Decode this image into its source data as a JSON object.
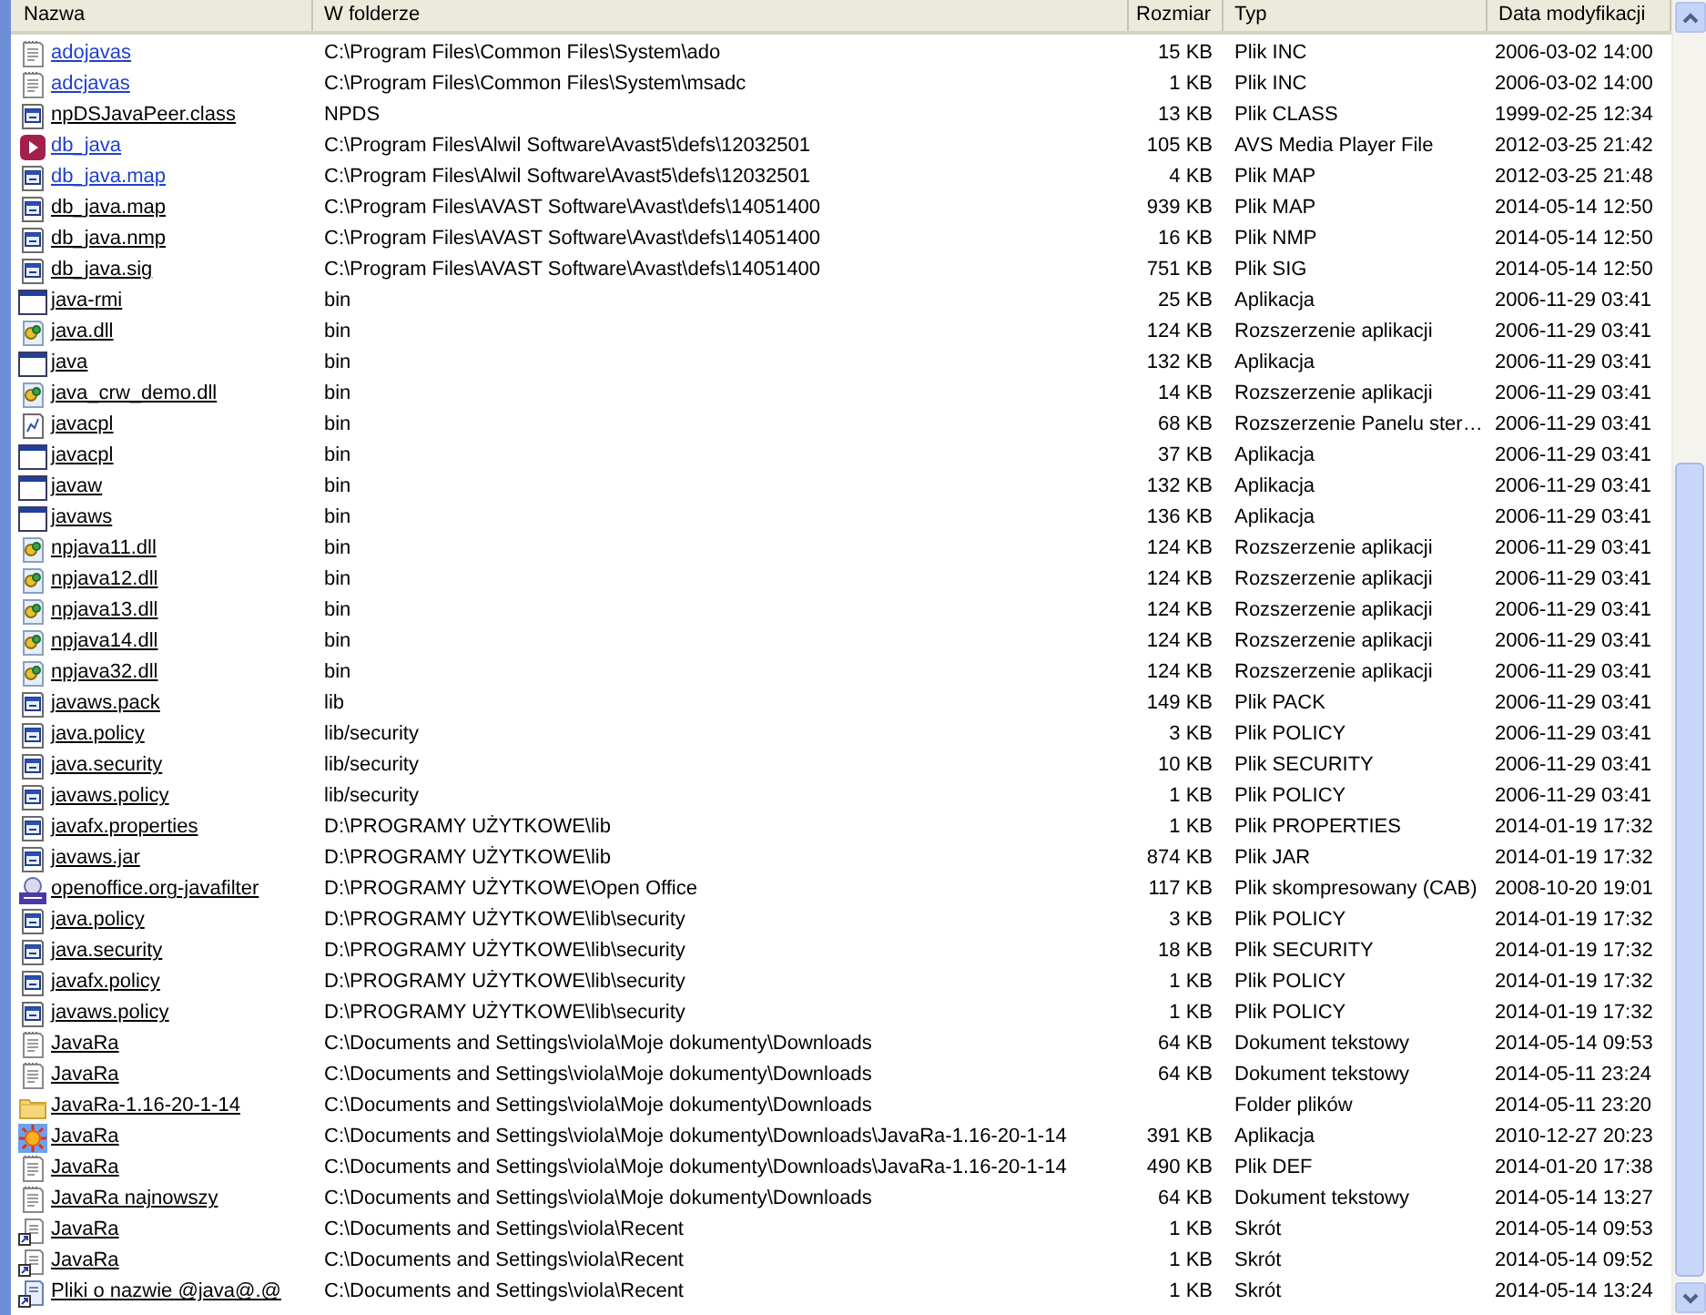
{
  "columns": [
    "Nazwa",
    "W folderze",
    "Rozmiar",
    "Typ",
    "Data modyfikacji"
  ],
  "rows": [
    {
      "kind": "text",
      "name": "adojavas",
      "visited": true,
      "folder": "C:\\Program Files\\Common Files\\System\\ado",
      "size": "15 KB",
      "type": "Plik INC",
      "date": "2006-03-02 14:00"
    },
    {
      "kind": "text",
      "name": "adcjavas",
      "visited": true,
      "folder": "C:\\Program Files\\Common Files\\System\\msadc",
      "size": "1 KB",
      "type": "Plik INC",
      "date": "2006-03-02 14:00"
    },
    {
      "kind": "doc",
      "name": "npDSJavaPeer.class",
      "visited": false,
      "folder": "NPDS",
      "size": "13 KB",
      "type": "Plik CLASS",
      "date": "1999-02-25 12:34"
    },
    {
      "kind": "media",
      "name": "db_java",
      "visited": true,
      "folder": "C:\\Program Files\\Alwil Software\\Avast5\\defs\\12032501",
      "size": "105 KB",
      "type": "AVS Media Player File",
      "date": "2012-03-25 21:42"
    },
    {
      "kind": "doc",
      "name": "db_java.map",
      "visited": true,
      "folder": "C:\\Program Files\\Alwil Software\\Avast5\\defs\\12032501",
      "size": "4 KB",
      "type": "Plik MAP",
      "date": "2012-03-25 21:48"
    },
    {
      "kind": "doc",
      "name": "db_java.map",
      "visited": false,
      "folder": "C:\\Program Files\\AVAST Software\\Avast\\defs\\14051400",
      "size": "939 KB",
      "type": "Plik MAP",
      "date": "2014-05-14 12:50"
    },
    {
      "kind": "doc",
      "name": "db_java.nmp",
      "visited": false,
      "folder": "C:\\Program Files\\AVAST Software\\Avast\\defs\\14051400",
      "size": "16 KB",
      "type": "Plik NMP",
      "date": "2014-05-14 12:50"
    },
    {
      "kind": "doc",
      "name": "db_java.sig",
      "visited": false,
      "folder": "C:\\Program Files\\AVAST Software\\Avast\\defs\\14051400",
      "size": "751 KB",
      "type": "Plik SIG",
      "date": "2014-05-14 12:50"
    },
    {
      "kind": "window",
      "name": "java-rmi",
      "visited": false,
      "folder": "bin",
      "size": "25 KB",
      "type": "Aplikacja",
      "date": "2006-11-29 03:41"
    },
    {
      "kind": "dll",
      "name": "java.dll",
      "visited": false,
      "folder": "bin",
      "size": "124 KB",
      "type": "Rozszerzenie aplikacji",
      "date": "2006-11-29 03:41"
    },
    {
      "kind": "window",
      "name": "java",
      "visited": false,
      "folder": "bin",
      "size": "132 KB",
      "type": "Aplikacja",
      "date": "2006-11-29 03:41"
    },
    {
      "kind": "dll",
      "name": "java_crw_demo.dll",
      "visited": false,
      "folder": "bin",
      "size": "14 KB",
      "type": "Rozszerzenie aplikacji",
      "date": "2006-11-29 03:41"
    },
    {
      "kind": "cpl",
      "name": "javacpl",
      "visited": false,
      "folder": "bin",
      "size": "68 KB",
      "type": "Rozszerzenie Panelu ster…",
      "date": "2006-11-29 03:41"
    },
    {
      "kind": "window",
      "name": "javacpl",
      "visited": false,
      "folder": "bin",
      "size": "37 KB",
      "type": "Aplikacja",
      "date": "2006-11-29 03:41"
    },
    {
      "kind": "window",
      "name": "javaw",
      "visited": false,
      "folder": "bin",
      "size": "132 KB",
      "type": "Aplikacja",
      "date": "2006-11-29 03:41"
    },
    {
      "kind": "window",
      "name": "javaws",
      "visited": false,
      "folder": "bin",
      "size": "136 KB",
      "type": "Aplikacja",
      "date": "2006-11-29 03:41"
    },
    {
      "kind": "dll",
      "name": "npjava11.dll",
      "visited": false,
      "folder": "bin",
      "size": "124 KB",
      "type": "Rozszerzenie aplikacji",
      "date": "2006-11-29 03:41"
    },
    {
      "kind": "dll",
      "name": "npjava12.dll",
      "visited": false,
      "folder": "bin",
      "size": "124 KB",
      "type": "Rozszerzenie aplikacji",
      "date": "2006-11-29 03:41"
    },
    {
      "kind": "dll",
      "name": "npjava13.dll",
      "visited": false,
      "folder": "bin",
      "size": "124 KB",
      "type": "Rozszerzenie aplikacji",
      "date": "2006-11-29 03:41"
    },
    {
      "kind": "dll",
      "name": "npjava14.dll",
      "visited": false,
      "folder": "bin",
      "size": "124 KB",
      "type": "Rozszerzenie aplikacji",
      "date": "2006-11-29 03:41"
    },
    {
      "kind": "dll",
      "name": "npjava32.dll",
      "visited": false,
      "folder": "bin",
      "size": "124 KB",
      "type": "Rozszerzenie aplikacji",
      "date": "2006-11-29 03:41"
    },
    {
      "kind": "doc",
      "name": "javaws.pack",
      "visited": false,
      "folder": "lib",
      "size": "149 KB",
      "type": "Plik PACK",
      "date": "2006-11-29 03:41"
    },
    {
      "kind": "doc",
      "name": "java.policy",
      "visited": false,
      "folder": "lib/security",
      "size": "3 KB",
      "type": "Plik POLICY",
      "date": "2006-11-29 03:41"
    },
    {
      "kind": "doc",
      "name": "java.security",
      "visited": false,
      "folder": "lib/security",
      "size": "10 KB",
      "type": "Plik SECURITY",
      "date": "2006-11-29 03:41"
    },
    {
      "kind": "doc",
      "name": "javaws.policy",
      "visited": false,
      "folder": "lib/security",
      "size": "1 KB",
      "type": "Plik POLICY",
      "date": "2006-11-29 03:41"
    },
    {
      "kind": "doc",
      "name": "javafx.properties",
      "visited": false,
      "folder": "D:\\PROGRAMY UŻYTKOWE\\lib",
      "size": "1 KB",
      "type": "Plik PROPERTIES",
      "date": "2014-01-19 17:32"
    },
    {
      "kind": "doc",
      "name": "javaws.jar",
      "visited": false,
      "folder": "D:\\PROGRAMY UŻYTKOWE\\lib",
      "size": "874 KB",
      "type": "Plik JAR",
      "date": "2014-01-19 17:32"
    },
    {
      "kind": "cab",
      "name": "openoffice.org-javafilter",
      "visited": false,
      "folder": "D:\\PROGRAMY UŻYTKOWE\\Open Office",
      "size": "117 KB",
      "type": "Plik skompresowany (CAB)",
      "date": "2008-10-20 19:01"
    },
    {
      "kind": "doc",
      "name": "java.policy",
      "visited": false,
      "folder": "D:\\PROGRAMY UŻYTKOWE\\lib\\security",
      "size": "3 KB",
      "type": "Plik POLICY",
      "date": "2014-01-19 17:32"
    },
    {
      "kind": "doc",
      "name": "java.security",
      "visited": false,
      "folder": "D:\\PROGRAMY UŻYTKOWE\\lib\\security",
      "size": "18 KB",
      "type": "Plik SECURITY",
      "date": "2014-01-19 17:32"
    },
    {
      "kind": "doc",
      "name": "javafx.policy",
      "visited": false,
      "folder": "D:\\PROGRAMY UŻYTKOWE\\lib\\security",
      "size": "1 KB",
      "type": "Plik POLICY",
      "date": "2014-01-19 17:32"
    },
    {
      "kind": "doc",
      "name": "javaws.policy",
      "visited": false,
      "folder": "D:\\PROGRAMY UŻYTKOWE\\lib\\security",
      "size": "1 KB",
      "type": "Plik POLICY",
      "date": "2014-01-19 17:32"
    },
    {
      "kind": "text",
      "name": "JavaRa",
      "visited": false,
      "folder": "C:\\Documents and Settings\\viola\\Moje dokumenty\\Downloads",
      "size": "64 KB",
      "type": "Dokument tekstowy",
      "date": "2014-05-14 09:53"
    },
    {
      "kind": "text",
      "name": "JavaRa",
      "visited": false,
      "folder": "C:\\Documents and Settings\\viola\\Moje dokumenty\\Downloads",
      "size": "64 KB",
      "type": "Dokument tekstowy",
      "date": "2014-05-11 23:24"
    },
    {
      "kind": "folder",
      "name": "JavaRa-1.16-20-1-14",
      "visited": false,
      "folder": "C:\\Documents and Settings\\viola\\Moje dokumenty\\Downloads",
      "type": "Folder plików",
      "date": "2014-05-11 23:20"
    },
    {
      "kind": "app",
      "name": "JavaRa",
      "visited": false,
      "folder": "C:\\Documents and Settings\\viola\\Moje dokumenty\\Downloads\\JavaRa-1.16-20-1-14",
      "size": "391 KB",
      "type": "Aplikacja",
      "date": "2010-12-27 20:23"
    },
    {
      "kind": "text",
      "name": "JavaRa",
      "visited": false,
      "folder": "C:\\Documents and Settings\\viola\\Moje dokumenty\\Downloads\\JavaRa-1.16-20-1-14",
      "size": "490 KB",
      "type": "Plik DEF",
      "date": "2014-01-20 17:38"
    },
    {
      "kind": "text",
      "name": "JavaRa najnowszy",
      "visited": false,
      "folder": "C:\\Documents and Settings\\viola\\Moje dokumenty\\Downloads",
      "size": "64 KB",
      "type": "Dokument tekstowy",
      "date": "2014-05-14 13:27"
    },
    {
      "kind": "shortcut",
      "name": "JavaRa",
      "visited": false,
      "folder": "C:\\Documents and Settings\\viola\\Recent",
      "size": "1 KB",
      "type": "Skrót",
      "date": "2014-05-14 09:53"
    },
    {
      "kind": "shortcut",
      "name": "JavaRa",
      "visited": false,
      "folder": "C:\\Documents and Settings\\viola\\Recent",
      "size": "1 KB",
      "type": "Skrót",
      "date": "2014-05-14 09:52"
    },
    {
      "kind": "shortcut-doc",
      "name": "Pliki o nazwie @java@.@",
      "visited": false,
      "folder": "C:\\Documents and Settings\\viola\\Recent",
      "size": "1 KB",
      "type": "Skrót",
      "date": "2014-05-14 13:24"
    }
  ]
}
